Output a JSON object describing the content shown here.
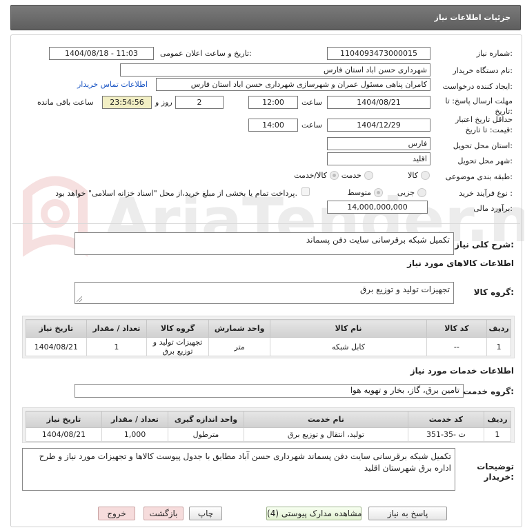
{
  "header": {
    "title": "جزئیات اطلاعات نیاز"
  },
  "form": {
    "need_number_label": "شماره نیاز:",
    "need_number": "1104093473000015",
    "announce_label": "تاریخ و ساعت اعلان عمومی:",
    "announce_value": "1404/08/18 - 11:03",
    "buyer_label": "نام دستگاه خریدار:",
    "buyer_value": "شهرداری حسن اباد استان فارس",
    "creator_label": "ایجاد کننده درخواست:",
    "creator_value": "کامران پناهی مسئول عمران و شهرسازی شهرداری حسن اباد استان فارس",
    "contact_link": "اطلاعات تماس خریدار",
    "deadline_label_1": "مهلت ارسال پاسخ: تا",
    "deadline_label_2": "تاریخ:",
    "deadline_date": "1404/08/21",
    "time_label": "ساعت",
    "deadline_time": "12:00",
    "days_value": "2",
    "days_label": "روز و",
    "remaining_value": "23:54:56",
    "remaining_label": "ساعت باقی مانده",
    "validity_label_1": "حداقل تاریخ اعتبار",
    "validity_label_2": "قیمت: تا تاریخ:",
    "validity_date": "1404/12/29",
    "validity_time": "14:00",
    "province_label": "استان محل تحویل:",
    "province_value": "فارس",
    "city_label": "شهر محل تحویل:",
    "city_value": "اقلید",
    "category_label": "طبقه بندی موضوعی:",
    "category_options": [
      "کالا",
      "خدمت",
      "کالا/خدمت"
    ],
    "category_selected": "کالا/خدمت",
    "process_label": "نوع فرآیند خرید :",
    "process_options": [
      "جزیی",
      "متوسط"
    ],
    "process_selected": "متوسط",
    "treasury_note": "پرداخت تمام یا بخشی از مبلغ خرید،از محل \"اسناد خزانه اسلامی\" خواهد بود.",
    "estimate_label": "برآورد مالی:",
    "estimate_value": "14,000,000,000"
  },
  "summary": {
    "label": "شرح کلی نیاز:",
    "value": "تکمیل شبکه برقرسانی سایت دفن پسماند"
  },
  "goods": {
    "section_title": "اطلاعات کالاهای مورد نیاز",
    "group_label": "گروه کالا:",
    "group_value": "تجهیزات تولید و توزیع برق",
    "columns": [
      "ردیف",
      "کد کالا",
      "نام کالا",
      "واحد شمارش",
      "گروه کالا",
      "تعداد / مقدار",
      "تاریخ نیاز"
    ],
    "rows": [
      {
        "row": "1",
        "code": "--",
        "name": "کابل شبکه",
        "unit": "متر",
        "group": "تجهیزات تولید و توزیع برق",
        "qty": "1",
        "date": "1404/08/21"
      }
    ]
  },
  "services": {
    "section_title": "اطلاعات خدمات مورد نیاز",
    "group_label": "گروه خدمت:",
    "group_value": "تامین برق، گاز، بخار و تهویه هوا",
    "columns": [
      "ردیف",
      "کد خدمت",
      "نام خدمت",
      "واحد اندازه گیری",
      "تعداد / مقدار",
      "تاریخ نیاز"
    ],
    "rows": [
      {
        "row": "1",
        "code": "ت -35-351",
        "name": "تولید، انتقال و توزیع برق",
        "unit": "مترطول",
        "qty": "1,000",
        "date": "1404/08/21"
      }
    ]
  },
  "notes": {
    "label_1": "توضیحات",
    "label_2": "خریدار:",
    "value": "تکمیل شبکه برقرسانی سایت دفن پسماند شهرداری حسن آباد مطابق با جدول پیوست کالاها و تجهیزات مورد نیاز و طرح اداره برق شهرستان اقلید"
  },
  "buttons": {
    "respond": "پاسخ به نیاز",
    "docs": "مشاهده مدارک پیوستی (4)",
    "print": "چاپ",
    "back": "بازگشت",
    "exit": "خروج"
  },
  "watermark": {
    "brand": "AriaTender.net"
  }
}
